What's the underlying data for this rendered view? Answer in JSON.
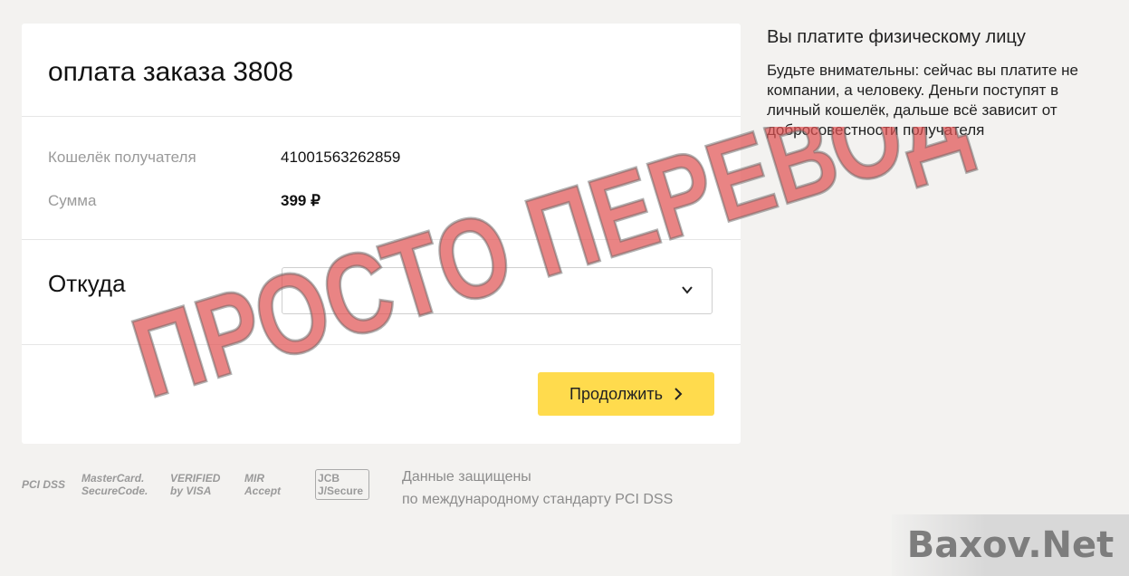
{
  "order": {
    "title": "оплата заказа 3808"
  },
  "details": {
    "wallet_label": "Кошелёк получателя",
    "wallet_value": "41001563262859",
    "amount_label": "Сумма",
    "amount_value": "399 ₽"
  },
  "source": {
    "label": "Откуда",
    "select_value": ""
  },
  "actions": {
    "continue_label": "Продолжить"
  },
  "side": {
    "title": "Вы платите физическому лицу",
    "text": "Будьте внимательны: сейчас вы платите не компании, а человеку. Деньги поступят в личный кошелёк, дальше всё зависит от добросовестности получателя"
  },
  "footer": {
    "logos": [
      "PCI DSS",
      "MasterCard. SecureCode.",
      "VERIFIED by VISA",
      "MIR Accept",
      "JCB J/Secure"
    ],
    "security_line1": "Данные защищены",
    "security_line2": "по международному стандарту PCI DSS"
  },
  "overlay": {
    "stamp_text": "ПРОСТО ПЕРЕВОД",
    "watermark_text": "Baxov.Net"
  },
  "colors": {
    "accent": "#ffdb4d",
    "stamp": "#e05050"
  }
}
